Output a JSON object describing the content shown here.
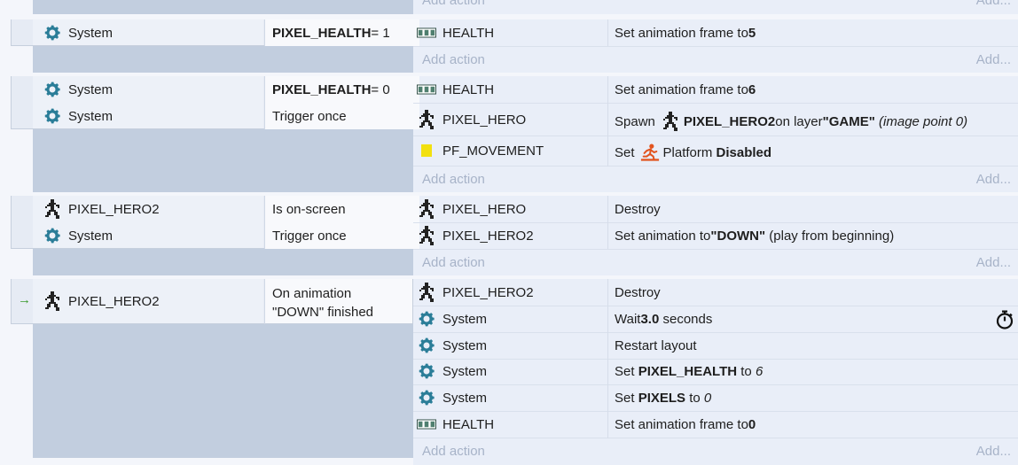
{
  "add_action_label": "Add action",
  "add_label": "Add...",
  "events": [
    {
      "conditions": [
        {
          "object": "System",
          "icon": "gear-icon",
          "text": "PIXEL_HEALTH",
          "suffix": " = 1"
        }
      ],
      "actions": [
        {
          "object": "HEALTH",
          "icon": "tiledbg-icon",
          "prefix": "Set animation frame to ",
          "value": "5"
        }
      ]
    },
    {
      "conditions": [
        {
          "object": "System",
          "icon": "gear-icon",
          "text": "PIXEL_HEALTH",
          "suffix": " = 0"
        },
        {
          "object": "System",
          "icon": "gear-icon",
          "text": "Trigger once"
        }
      ],
      "actions": [
        {
          "object": "HEALTH",
          "icon": "tiledbg-icon",
          "prefix": "Set animation frame to ",
          "value": "6"
        },
        {
          "object": "PIXEL_HERO",
          "icon": "sprite-hero-icon",
          "prefix": "Spawn",
          "target": "PIXEL_HERO2",
          "mid": " on layer ",
          "layer": "\"GAME\"",
          "note": " (image point 0)"
        },
        {
          "object": "PF_MOVEMENT",
          "icon": "yellow-square-icon",
          "prefix": "Set",
          "behavior": "Platform",
          "state": "Disabled"
        }
      ]
    },
    {
      "conditions": [
        {
          "object": "PIXEL_HERO2",
          "icon": "sprite-hero-icon",
          "text": "Is on-screen"
        },
        {
          "object": "System",
          "icon": "gear-icon",
          "text": "Trigger once"
        }
      ],
      "actions": [
        {
          "object": "PIXEL_HERO",
          "icon": "sprite-hero-icon",
          "text": "Destroy"
        },
        {
          "object": "PIXEL_HERO2",
          "icon": "sprite-hero-icon",
          "prefix": "Set animation to ",
          "value": "\"DOWN\"",
          "suffix": " (play from beginning)"
        }
      ]
    },
    {
      "trigger_arrow": "→",
      "conditions": [
        {
          "object": "PIXEL_HERO2",
          "icon": "sprite-hero-icon",
          "line1": "On animation",
          "line2": "\"DOWN\" finished"
        }
      ],
      "actions": [
        {
          "object": "PIXEL_HERO2",
          "icon": "sprite-hero-icon",
          "text": "Destroy"
        },
        {
          "object": "System",
          "icon": "gear-icon",
          "prefix": "Wait ",
          "value": "3.0",
          "suffix": " seconds"
        },
        {
          "object": "System",
          "icon": "gear-icon",
          "text": "Restart layout"
        },
        {
          "object": "System",
          "icon": "gear-icon",
          "prefix": "Set ",
          "value": "PIXEL_HEALTH",
          "mid": " to ",
          "italic": "6"
        },
        {
          "object": "System",
          "icon": "gear-icon",
          "prefix": "Set ",
          "value": "PIXELS",
          "mid": " to ",
          "italic": "0"
        },
        {
          "object": "HEALTH",
          "icon": "tiledbg-icon",
          "prefix": "Set animation frame to ",
          "value": "0"
        }
      ]
    }
  ]
}
